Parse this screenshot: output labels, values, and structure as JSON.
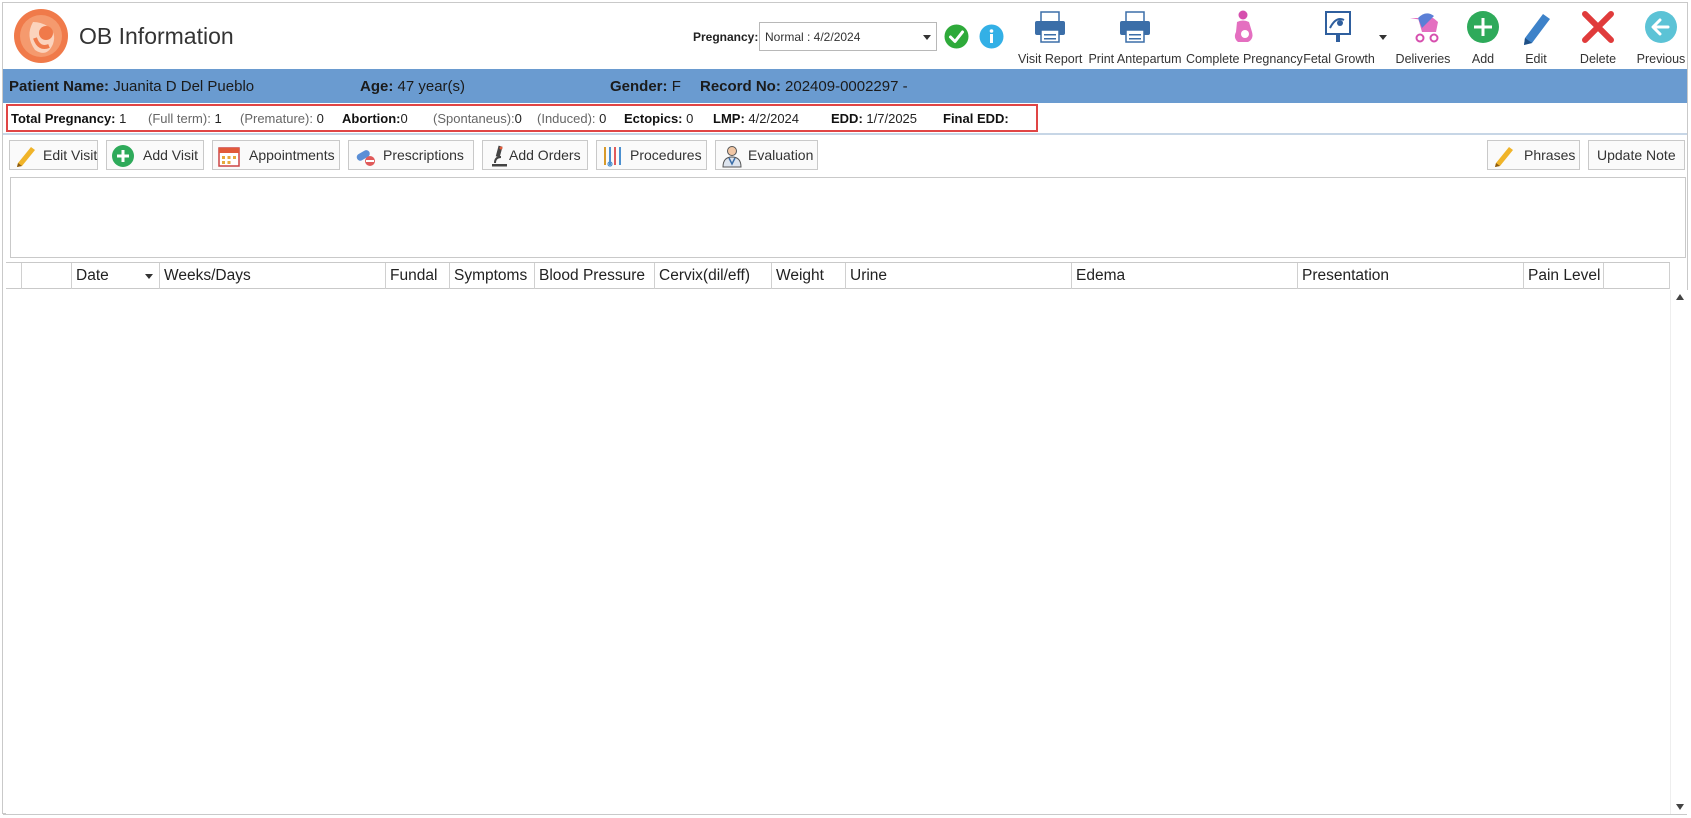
{
  "app": {
    "title": "OB Information"
  },
  "pregnancy": {
    "label": "Pregnancy:",
    "selected": "Normal : 4/2/2024"
  },
  "toolbar": {
    "visit_report": "Visit Report",
    "print_antepartum": "Print Antepartum",
    "complete_pregnancy": "Complete Pregnancy",
    "fetal_growth": "Fetal Growth",
    "deliveries": "Deliveries",
    "add": "Add",
    "edit": "Edit",
    "delete": "Delete",
    "previous": "Previous"
  },
  "patient": {
    "name_label": "Patient Name:",
    "name": "Juanita D Del Pueblo",
    "age_label": "Age:",
    "age": "47 year(s)",
    "gender_label": "Gender:",
    "gender": "F",
    "record_label": "Record No:",
    "record": "202409-0002297 -"
  },
  "summary": {
    "total_label": "Total Pregnancy:",
    "total": "1",
    "fullterm_label": "(Full term):",
    "fullterm": "1",
    "premature_label": "(Premature):",
    "premature": "0",
    "abortion_label": "Abortion:",
    "abortion": "0",
    "spontaneus_label": "(Spontaneus):",
    "spontaneus": "0",
    "induced_label": "(Induced):",
    "induced": "0",
    "ectopics_label": "Ectopics:",
    "ectopics": "0",
    "lmp_label": "LMP:",
    "lmp": "4/2/2024",
    "edd_label": "EDD:",
    "edd": "1/7/2025",
    "final_edd_label": "Final EDD:",
    "final_edd": ""
  },
  "actions": {
    "edit_visit": "Edit Visit",
    "add_visit": "Add Visit",
    "appointments": "Appointments",
    "prescriptions": "Prescriptions",
    "add_orders": "Add Orders",
    "procedures": "Procedures",
    "evaluation": "Evaluation",
    "phrases": "Phrases",
    "update_note": "Update Note"
  },
  "grid": {
    "columns": [
      "Date",
      "Weeks/Days",
      "Fundal",
      "Symptoms",
      "Blood Pressure",
      "Cervix(dil/eff)",
      "Weight",
      "Urine",
      "Edema",
      "Presentation",
      "Pain Level"
    ]
  },
  "colors": {
    "patient_bar": "#6a9bd0",
    "highlight_border": "#e04545"
  },
  "icons": [
    "fetus-logo-icon",
    "check-icon",
    "info-icon",
    "printer-icon",
    "pregnant-icon",
    "fetal-growth-icon",
    "stroller-icon",
    "plus-icon",
    "pencil-icon",
    "x-icon",
    "back-arrow-icon",
    "calendar-icon",
    "pills-icon",
    "microscope-icon",
    "instruments-icon",
    "doctor-icon"
  ]
}
